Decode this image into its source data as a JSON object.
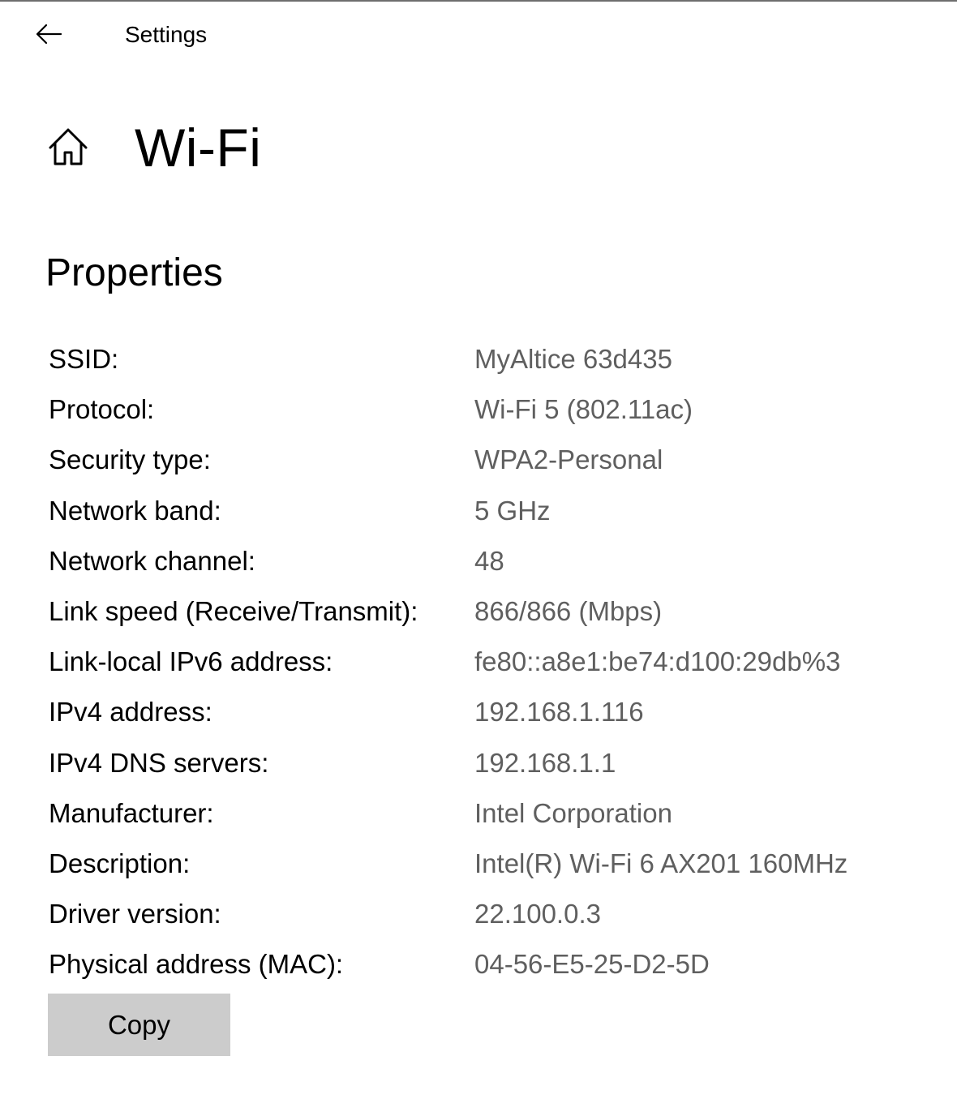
{
  "header": {
    "back_icon": "back-arrow-icon",
    "app_title": "Settings"
  },
  "page": {
    "home_icon": "home-icon",
    "title": "Wi-Fi"
  },
  "properties": {
    "section_title": "Properties",
    "items": [
      {
        "label": "SSID:",
        "value": "MyAltice 63d435"
      },
      {
        "label": "Protocol:",
        "value": "Wi-Fi 5 (802.11ac)"
      },
      {
        "label": "Security type:",
        "value": "WPA2-Personal"
      },
      {
        "label": "Network band:",
        "value": "5 GHz"
      },
      {
        "label": "Network channel:",
        "value": "48"
      },
      {
        "label": "Link speed (Receive/Transmit):",
        "value": "866/866 (Mbps)"
      },
      {
        "label": "Link-local IPv6 address:",
        "value": "fe80::a8e1:be74:d100:29db%3"
      },
      {
        "label": "IPv4 address:",
        "value": "192.168.1.116"
      },
      {
        "label": "IPv4 DNS servers:",
        "value": "192.168.1.1"
      },
      {
        "label": "Manufacturer:",
        "value": "Intel Corporation"
      },
      {
        "label": "Description:",
        "value": "Intel(R) Wi-Fi 6 AX201 160MHz"
      },
      {
        "label": "Driver version:",
        "value": "22.100.0.3"
      },
      {
        "label": "Physical address (MAC):",
        "value": "04-56-E5-25-D2-5D"
      }
    ],
    "copy_label": "Copy"
  },
  "colors": {
    "label_text": "#000000",
    "value_text": "#5f5f5f",
    "button_bg": "#cccccc",
    "top_border": "#6e6e6e"
  }
}
